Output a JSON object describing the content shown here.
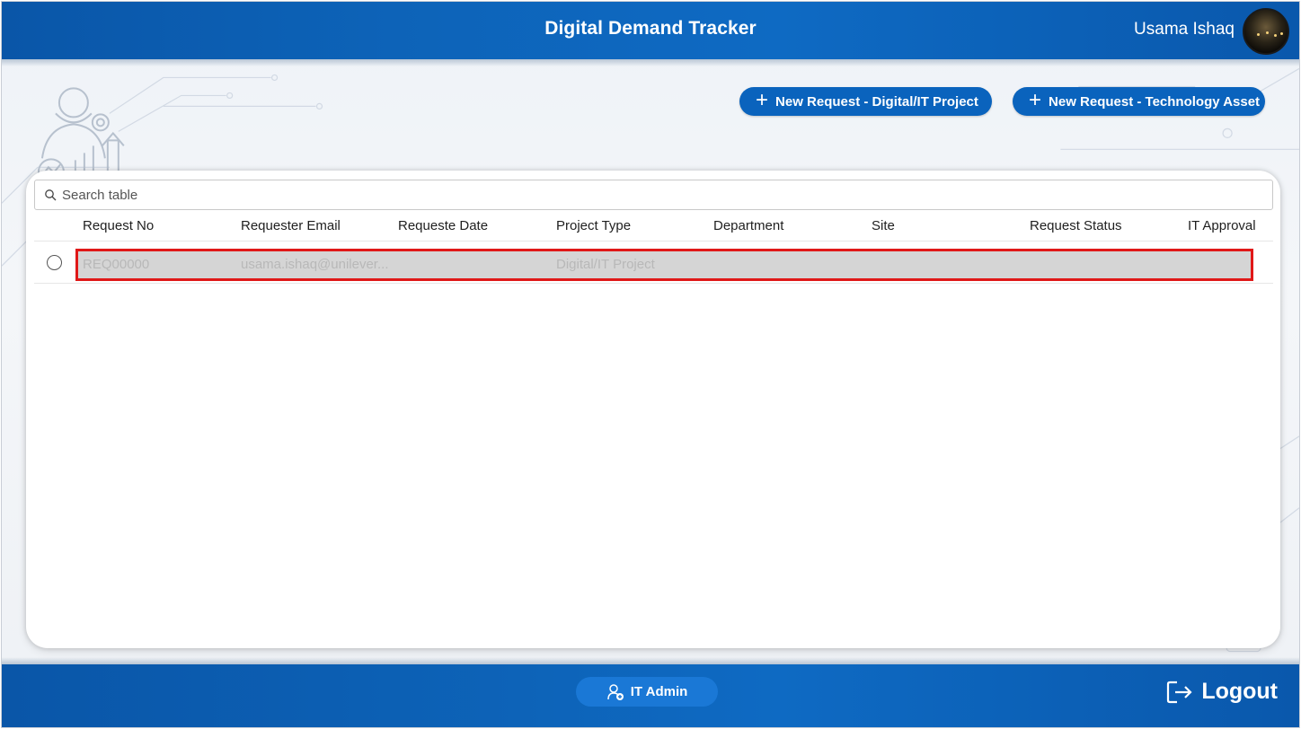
{
  "header": {
    "title": "Digital Demand Tracker",
    "user_name": "Usama Ishaq"
  },
  "actions": {
    "new_digital_project": "New Request - Digital/IT Project",
    "new_technology_asset": "New Request - Technology Asset"
  },
  "table": {
    "search_placeholder": "Search table",
    "columns": [
      "Request No",
      "Requester Email",
      "Requeste Date",
      "Project Type",
      "Department",
      "Site",
      "Request Status",
      "IT Approval"
    ],
    "rows": [
      {
        "request_no": "REQ00000",
        "requester_email": "usama.ishaq@unilever...",
        "request_date": "",
        "project_type": "Digital/IT Project",
        "department": "",
        "site": "",
        "request_status": "",
        "it_approval": ""
      }
    ]
  },
  "footer": {
    "admin_label": "IT Admin",
    "logout_label": "Logout"
  },
  "colors": {
    "brand_blue": "#0a63bd",
    "highlight_border": "#e01818"
  }
}
